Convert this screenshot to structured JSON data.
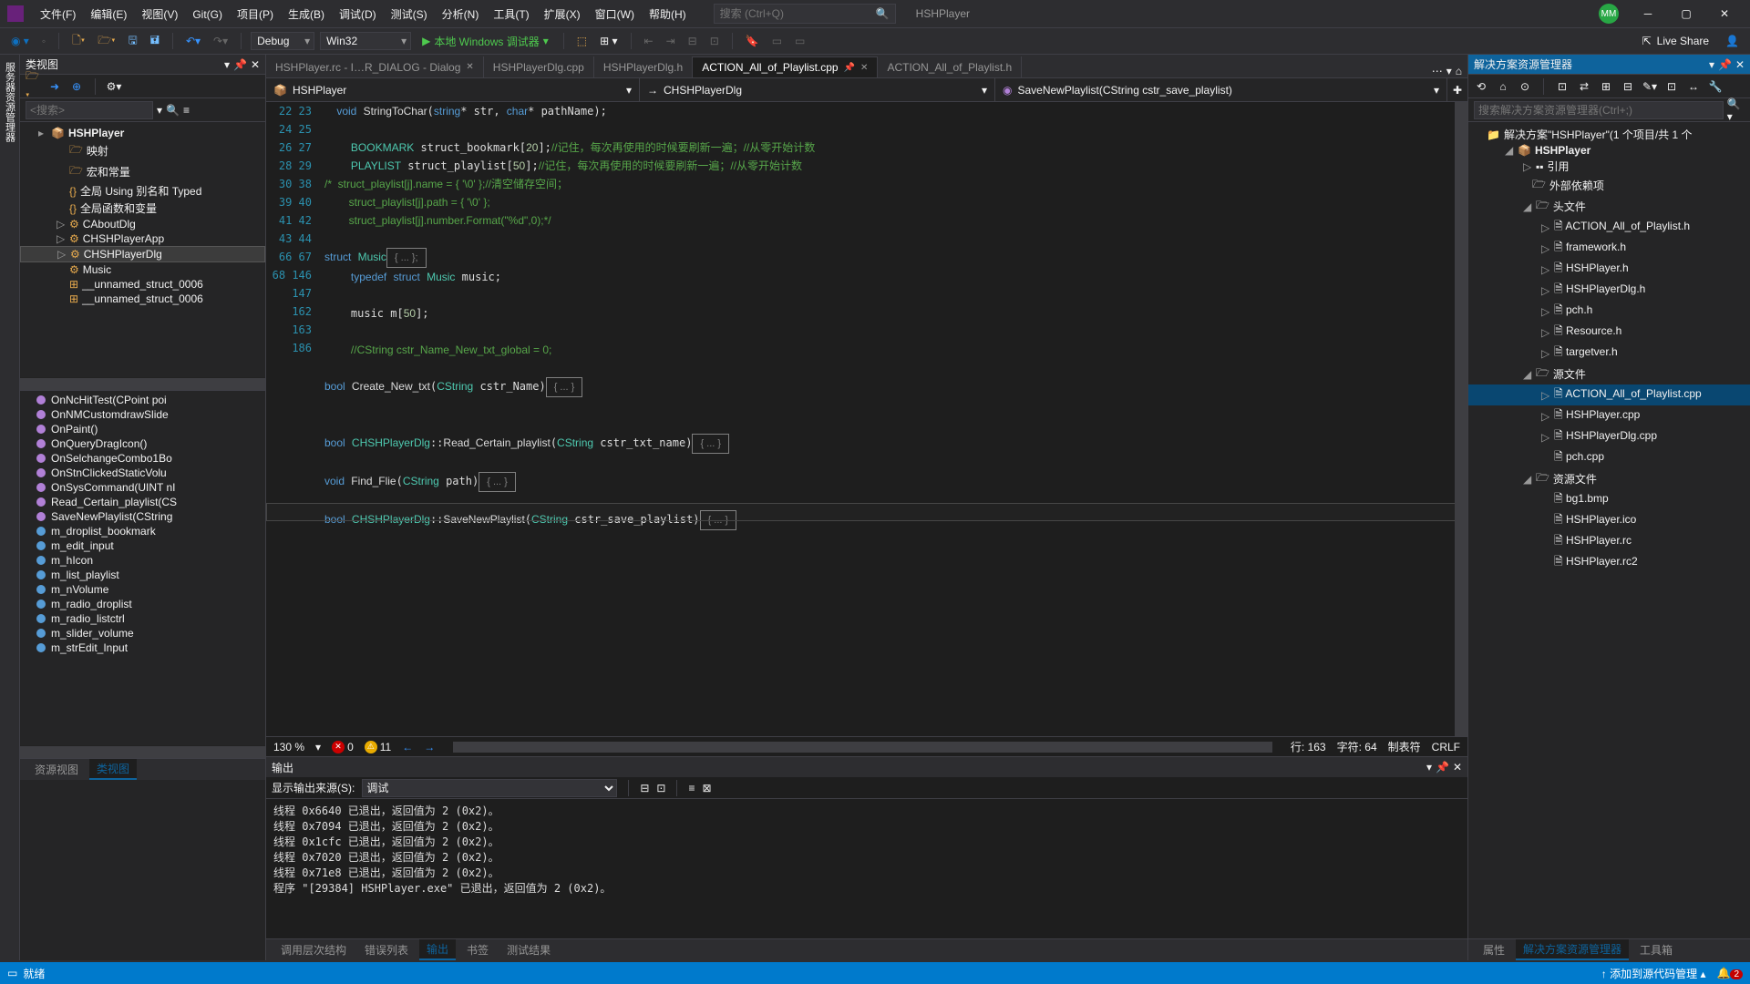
{
  "menu": [
    "文件(F)",
    "编辑(E)",
    "视图(V)",
    "Git(G)",
    "项目(P)",
    "生成(B)",
    "调试(D)",
    "测试(S)",
    "分析(N)",
    "工具(T)",
    "扩展(X)",
    "窗口(W)",
    "帮助(H)"
  ],
  "search_placeholder": "搜索 (Ctrl+Q)",
  "app_title": "HSHPlayer",
  "avatar": "MM",
  "config": "Debug",
  "platform": "Win32",
  "run_label": "本地 Windows 调试器",
  "live_share": "Live Share",
  "class_view": {
    "title": "类视图",
    "search_placeholder": "<搜索>",
    "root": "HSHPlayer",
    "items": [
      "映射",
      "宏和常量",
      "全局 Using 别名和 Typed",
      "全局函数和变量",
      "CAboutDlg",
      "CHSHPlayerApp",
      "CHSHPlayerDlg",
      "Music",
      "__unnamed_struct_0006",
      "__unnamed_struct_0006"
    ],
    "members": [
      {
        "k": "p",
        "t": "OnNcHitTest(CPoint poi"
      },
      {
        "k": "p",
        "t": "OnNMCustomdrawSlide"
      },
      {
        "k": "p",
        "t": "OnPaint()"
      },
      {
        "k": "p",
        "t": "OnQueryDragIcon()"
      },
      {
        "k": "p",
        "t": "OnSelchangeCombo1Bo"
      },
      {
        "k": "p",
        "t": "OnStnClickedStaticVolu"
      },
      {
        "k": "p",
        "t": "OnSysCommand(UINT nI"
      },
      {
        "k": "p",
        "t": "Read_Certain_playlist(CS"
      },
      {
        "k": "p",
        "t": "SaveNewPlaylist(CString"
      },
      {
        "k": "b",
        "t": "m_droplist_bookmark"
      },
      {
        "k": "b",
        "t": "m_edit_input"
      },
      {
        "k": "b",
        "t": "m_hIcon"
      },
      {
        "k": "b",
        "t": "m_list_playlist"
      },
      {
        "k": "b",
        "t": "m_nVolume"
      },
      {
        "k": "b",
        "t": "m_radio_droplist"
      },
      {
        "k": "b",
        "t": "m_radio_listctrl"
      },
      {
        "k": "b",
        "t": "m_slider_volume"
      },
      {
        "k": "b",
        "t": "m_strEdit_Input"
      }
    ]
  },
  "tabs": [
    {
      "label": "HSHPlayer.rc - I…R_DIALOG - Dialog",
      "active": false,
      "close": true
    },
    {
      "label": "HSHPlayerDlg.cpp",
      "active": false
    },
    {
      "label": "HSHPlayerDlg.h",
      "active": false
    },
    {
      "label": "ACTION_All_of_Playlist.cpp",
      "active": true,
      "pin": true,
      "close": true
    },
    {
      "label": "ACTION_All_of_Playlist.h",
      "active": false
    }
  ],
  "nav": {
    "scope": "HSHPlayer",
    "class": "CHSHPlayerDlg",
    "method": "SaveNewPlaylist(CString cstr_save_playlist)"
  },
  "line_numbers": [
    "22",
    "23",
    "24",
    "25",
    "26",
    "27",
    "28",
    "29",
    "30",
    "38",
    "39",
    "40",
    "41",
    "42",
    "43",
    "44",
    "66",
    "67",
    "68",
    "146",
    "147",
    "162",
    "163",
    "186"
  ],
  "status_line": {
    "zoom": "130 %",
    "errors": "0",
    "warnings": "11",
    "line": "行: 163",
    "col": "字符: 64",
    "tabs": "制表符",
    "eol": "CRLF"
  },
  "output": {
    "title": "输出",
    "source_label": "显示输出来源(S):",
    "source_value": "调试",
    "body": "线程 0x6640 已退出，返回值为 2 (0x2)。\n线程 0x7094 已退出，返回值为 2 (0x2)。\n线程 0x1cfc 已退出，返回值为 2 (0x2)。\n线程 0x7020 已退出，返回值为 2 (0x2)。\n线程 0x71e8 已退出，返回值为 2 (0x2)。\n程序 \"[29384] HSHPlayer.exe\" 已退出，返回值为 2 (0x2)。"
  },
  "bottom_tabs_left": [
    "资源视图",
    "类视图"
  ],
  "bottom_tabs_center": [
    "调用层次结构",
    "错误列表",
    "输出",
    "书签",
    "测试结果"
  ],
  "bottom_tabs_right": [
    "属性",
    "解决方案资源管理器",
    "工具箱"
  ],
  "solution": {
    "title": "解决方案资源管理器",
    "search_placeholder": "搜索解决方案资源管理器(Ctrl+;)",
    "root": "解决方案\"HSHPlayer\"(1 个项目/共 1 个",
    "project": "HSHPlayer",
    "refs": "引用",
    "external": "外部依赖项",
    "headers_label": "头文件",
    "headers": [
      "ACTION_All_of_Playlist.h",
      "framework.h",
      "HSHPlayer.h",
      "HSHPlayerDlg.h",
      "pch.h",
      "Resource.h",
      "targetver.h"
    ],
    "sources_label": "源文件",
    "sources": [
      "ACTION_All_of_Playlist.cpp",
      "HSHPlayer.cpp",
      "HSHPlayerDlg.cpp",
      "pch.cpp"
    ],
    "resources_label": "资源文件",
    "resources": [
      "bg1.bmp",
      "HSHPlayer.ico",
      "HSHPlayer.rc",
      "HSHPlayer.rc2"
    ]
  },
  "status_bar": {
    "ready": "就绪",
    "source_control": "添加到源代码管理",
    "notif": "2"
  },
  "left_rail": "服务器资源管理器"
}
